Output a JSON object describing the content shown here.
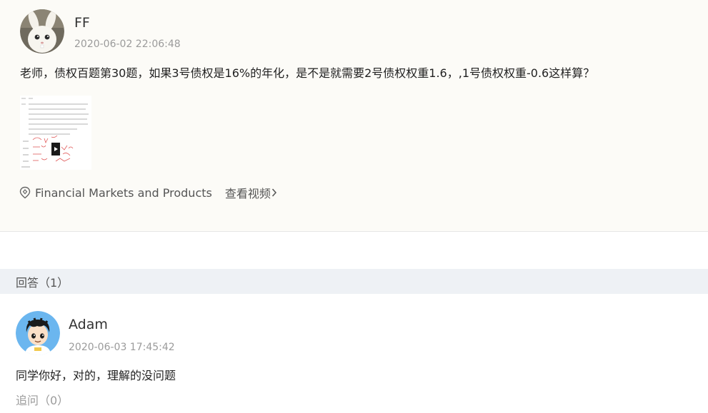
{
  "question": {
    "username": "FF",
    "timestamp": "2020-06-02 22:06:48",
    "text": "老师，债权百题第30题，如果3号债权是16%的年化，是不是就需要2号债权权重1.6，,1号债权权重-0.6这样算？",
    "avatar_icon": "rabbit-avatar-icon",
    "course": "Financial Markets and Products",
    "view_video_label": "查看视频"
  },
  "answers": {
    "title": "回答（1）",
    "items": [
      {
        "username": "Adam",
        "timestamp": "2020-06-03 17:45:42",
        "text": "同学你好，对的，理解的没问题",
        "avatar_icon": "cartoon-boy-avatar-icon",
        "followup_label": "追问（0）"
      }
    ]
  },
  "colors": {
    "card_bg": "#fcfbf7",
    "bar_bg": "#eef1f5",
    "muted_text": "#9b9b9b",
    "body_text": "#222222"
  }
}
